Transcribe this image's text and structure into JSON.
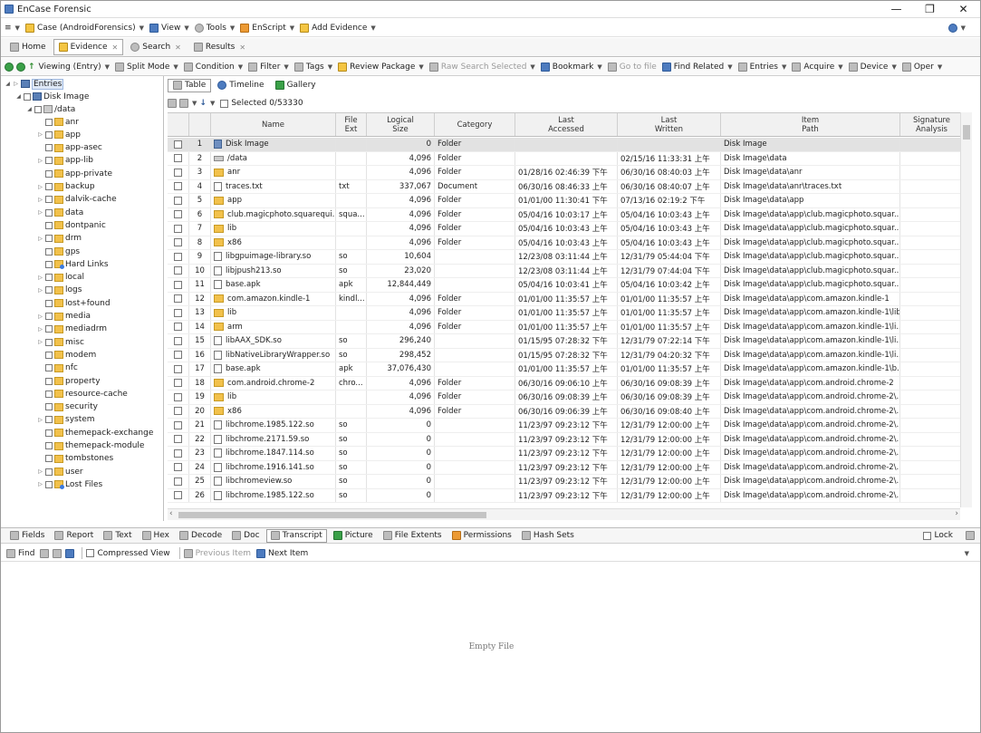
{
  "window": {
    "title": "EnCase Forensic",
    "minimize": "—",
    "maximize": "❐",
    "close": "✕"
  },
  "menubar": {
    "case_label": "Case (AndroidForensics)",
    "view_label": "View",
    "tools_label": "Tools",
    "enscript_label": "EnScript",
    "add_evidence_label": "Add Evidence",
    "help_label": "?"
  },
  "tabs": {
    "home": "Home",
    "evidence": "Evidence",
    "search": "Search",
    "results": "Results",
    "close": "✕"
  },
  "toolbar": {
    "viewing": "Viewing (Entry)",
    "split_mode": "Split Mode",
    "condition": "Condition",
    "filter": "Filter",
    "tags": "Tags",
    "review_package": "Review Package",
    "raw_search": "Raw Search Selected",
    "bookmark": "Bookmark",
    "go_to_file": "Go to file",
    "find_related": "Find Related",
    "entries": "Entries",
    "acquire": "Acquire",
    "device": "Device",
    "open": "Oper"
  },
  "tree": {
    "root": "Entries",
    "disk": "Disk Image",
    "data": "/data",
    "children": [
      "anr",
      "app",
      "app-asec",
      "app-lib",
      "app-private",
      "backup",
      "dalvik-cache",
      "data",
      "dontpanic",
      "drm",
      "gps",
      "Hard Links",
      "local",
      "logs",
      "lost+found",
      "media",
      "mediadrm",
      "misc",
      "modem",
      "nfc",
      "property",
      "resource-cache",
      "security",
      "system",
      "themepack-exchange",
      "themepack-module",
      "tombstones",
      "user",
      "Lost Files"
    ]
  },
  "view_tabs": {
    "table": "Table",
    "timeline": "Timeline",
    "gallery": "Gallery"
  },
  "selected_label": "Selected 0/53330",
  "columns": {
    "name": "Name",
    "file_ext": "File\nExt",
    "logical_size": "Logical\nSize",
    "category": "Category",
    "last_accessed": "Last\nAccessed",
    "last_written": "Last\nWritten",
    "item_path": "Item\nPath",
    "signature": "Signature\nAnalysis"
  },
  "rows": [
    {
      "n": "1",
      "icon": "disk",
      "name": "Disk Image",
      "ext": "",
      "size": "0",
      "cat": "Folder",
      "acc": "",
      "wri": "",
      "path": "Disk Image"
    },
    {
      "n": "2",
      "icon": "drv",
      "name": "/data",
      "ext": "",
      "size": "4,096",
      "cat": "Folder",
      "acc": "",
      "wri": "02/15/16 11:33:31 上午",
      "path": "Disk Image\\data"
    },
    {
      "n": "3",
      "icon": "folder",
      "name": "anr",
      "ext": "",
      "size": "4,096",
      "cat": "Folder",
      "acc": "01/28/16 02:46:39 下午",
      "wri": "06/30/16 08:40:03 上午",
      "path": "Disk Image\\data\\anr"
    },
    {
      "n": "4",
      "icon": "file",
      "name": "traces.txt",
      "ext": "txt",
      "size": "337,067",
      "cat": "Document",
      "acc": "06/30/16 08:46:33 上午",
      "wri": "06/30/16 08:40:07 上午",
      "path": "Disk Image\\data\\anr\\traces.txt"
    },
    {
      "n": "5",
      "icon": "folder",
      "name": "app",
      "ext": "",
      "size": "4,096",
      "cat": "Folder",
      "acc": "01/01/00 11:30:41 下午",
      "wri": "07/13/16 02:19:2 下午",
      "path": "Disk Image\\data\\app"
    },
    {
      "n": "6",
      "icon": "folder",
      "name": "club.magicphoto.squarequi...",
      "ext": "squa...",
      "size": "4,096",
      "cat": "Folder",
      "acc": "05/04/16 10:03:17 上午",
      "wri": "05/04/16 10:03:43 上午",
      "path": "Disk Image\\data\\app\\club.magicphoto.squar..."
    },
    {
      "n": "7",
      "icon": "folder",
      "name": "lib",
      "ext": "",
      "size": "4,096",
      "cat": "Folder",
      "acc": "05/04/16 10:03:43 上午",
      "wri": "05/04/16 10:03:43 上午",
      "path": "Disk Image\\data\\app\\club.magicphoto.squar..."
    },
    {
      "n": "8",
      "icon": "folder",
      "name": "x86",
      "ext": "",
      "size": "4,096",
      "cat": "Folder",
      "acc": "05/04/16 10:03:43 上午",
      "wri": "05/04/16 10:03:43 上午",
      "path": "Disk Image\\data\\app\\club.magicphoto.squar..."
    },
    {
      "n": "9",
      "icon": "file",
      "name": "libgpuimage-library.so",
      "ext": "so",
      "size": "10,604",
      "cat": "",
      "acc": "12/23/08 03:11:44 上午",
      "wri": "12/31/79 05:44:04 下午",
      "path": "Disk Image\\data\\app\\club.magicphoto.squar..."
    },
    {
      "n": "10",
      "icon": "file",
      "name": "libjpush213.so",
      "ext": "so",
      "size": "23,020",
      "cat": "",
      "acc": "12/23/08 03:11:44 上午",
      "wri": "12/31/79 07:44:04 下午",
      "path": "Disk Image\\data\\app\\club.magicphoto.squar..."
    },
    {
      "n": "11",
      "icon": "file",
      "name": "base.apk",
      "ext": "apk",
      "size": "12,844,449",
      "cat": "",
      "acc": "05/04/16 10:03:41 上午",
      "wri": "05/04/16 10:03:42 上午",
      "path": "Disk Image\\data\\app\\club.magicphoto.squar..."
    },
    {
      "n": "12",
      "icon": "folder",
      "name": "com.amazon.kindle-1",
      "ext": "kindl...",
      "size": "4,096",
      "cat": "Folder",
      "acc": "01/01/00 11:35:57 上午",
      "wri": "01/01/00 11:35:57 上午",
      "path": "Disk Image\\data\\app\\com.amazon.kindle-1"
    },
    {
      "n": "13",
      "icon": "folder",
      "name": "lib",
      "ext": "",
      "size": "4,096",
      "cat": "Folder",
      "acc": "01/01/00 11:35:57 上午",
      "wri": "01/01/00 11:35:57 上午",
      "path": "Disk Image\\data\\app\\com.amazon.kindle-1\\lib"
    },
    {
      "n": "14",
      "icon": "folder",
      "name": "arm",
      "ext": "",
      "size": "4,096",
      "cat": "Folder",
      "acc": "01/01/00 11:35:57 上午",
      "wri": "01/01/00 11:35:57 上午",
      "path": "Disk Image\\data\\app\\com.amazon.kindle-1\\li..."
    },
    {
      "n": "15",
      "icon": "file",
      "name": "libAAX_SDK.so",
      "ext": "so",
      "size": "296,240",
      "cat": "",
      "acc": "01/15/95 07:28:32 下午",
      "wri": "12/31/79 07:22:14 下午",
      "path": "Disk Image\\data\\app\\com.amazon.kindle-1\\li..."
    },
    {
      "n": "16",
      "icon": "file",
      "name": "libNativeLibraryWrapper.so",
      "ext": "so",
      "size": "298,452",
      "cat": "",
      "acc": "01/15/95 07:28:32 下午",
      "wri": "12/31/79 04:20:32 下午",
      "path": "Disk Image\\data\\app\\com.amazon.kindle-1\\li..."
    },
    {
      "n": "17",
      "icon": "file",
      "name": "base.apk",
      "ext": "apk",
      "size": "37,076,430",
      "cat": "",
      "acc": "01/01/00 11:35:57 上午",
      "wri": "01/01/00 11:35:57 上午",
      "path": "Disk Image\\data\\app\\com.amazon.kindle-1\\b..."
    },
    {
      "n": "18",
      "icon": "folder",
      "name": "com.android.chrome-2",
      "ext": "chro...",
      "size": "4,096",
      "cat": "Folder",
      "acc": "06/30/16 09:06:10 上午",
      "wri": "06/30/16 09:08:39 上午",
      "path": "Disk Image\\data\\app\\com.android.chrome-2"
    },
    {
      "n": "19",
      "icon": "folder",
      "name": "lib",
      "ext": "",
      "size": "4,096",
      "cat": "Folder",
      "acc": "06/30/16 09:08:39 上午",
      "wri": "06/30/16 09:08:39 上午",
      "path": "Disk Image\\data\\app\\com.android.chrome-2\\..."
    },
    {
      "n": "20",
      "icon": "folder",
      "name": "x86",
      "ext": "",
      "size": "4,096",
      "cat": "Folder",
      "acc": "06/30/16 09:06:39 上午",
      "wri": "06/30/16 09:08:40 上午",
      "path": "Disk Image\\data\\app\\com.android.chrome-2\\..."
    },
    {
      "n": "21",
      "icon": "file",
      "name": "libchrome.1985.122.so",
      "ext": "so",
      "size": "0",
      "cat": "",
      "acc": "11/23/97 09:23:12 下午",
      "wri": "12/31/79 12:00:00 上午",
      "path": "Disk Image\\data\\app\\com.android.chrome-2\\..."
    },
    {
      "n": "22",
      "icon": "file",
      "name": "libchrome.2171.59.so",
      "ext": "so",
      "size": "0",
      "cat": "",
      "acc": "11/23/97 09:23:12 下午",
      "wri": "12/31/79 12:00:00 上午",
      "path": "Disk Image\\data\\app\\com.android.chrome-2\\..."
    },
    {
      "n": "23",
      "icon": "file",
      "name": "libchrome.1847.114.so",
      "ext": "so",
      "size": "0",
      "cat": "",
      "acc": "11/23/97 09:23:12 下午",
      "wri": "12/31/79 12:00:00 上午",
      "path": "Disk Image\\data\\app\\com.android.chrome-2\\..."
    },
    {
      "n": "24",
      "icon": "file",
      "name": "libchrome.1916.141.so",
      "ext": "so",
      "size": "0",
      "cat": "",
      "acc": "11/23/97 09:23:12 下午",
      "wri": "12/31/79 12:00:00 上午",
      "path": "Disk Image\\data\\app\\com.android.chrome-2\\..."
    },
    {
      "n": "25",
      "icon": "file",
      "name": "libchromeview.so",
      "ext": "so",
      "size": "0",
      "cat": "",
      "acc": "11/23/97 09:23:12 下午",
      "wri": "12/31/79 12:00:00 上午",
      "path": "Disk Image\\data\\app\\com.android.chrome-2\\..."
    },
    {
      "n": "26",
      "icon": "file",
      "name": "libchrome.1985.122.so",
      "ext": "so",
      "size": "0",
      "cat": "",
      "acc": "11/23/97 09:23:12 下午",
      "wri": "12/31/79 12:00:00 上午",
      "path": "Disk Image\\data\\app\\com.android.chrome-2\\..."
    }
  ],
  "bottom_tabs": {
    "fields": "Fields",
    "report": "Report",
    "text": "Text",
    "hex": "Hex",
    "decode": "Decode",
    "doc": "Doc",
    "transcript": "Transcript",
    "picture": "Picture",
    "file_extents": "File Extents",
    "permissions": "Permissions",
    "hash_sets": "Hash Sets",
    "lock": "Lock"
  },
  "bottom_tools": {
    "find": "Find",
    "compressed_view": "Compressed View",
    "previous_item": "Previous Item",
    "next_item": "Next Item"
  },
  "empty_text": "Empty File",
  "icons": {
    "scroll_left": "‹",
    "scroll_right": "›"
  }
}
